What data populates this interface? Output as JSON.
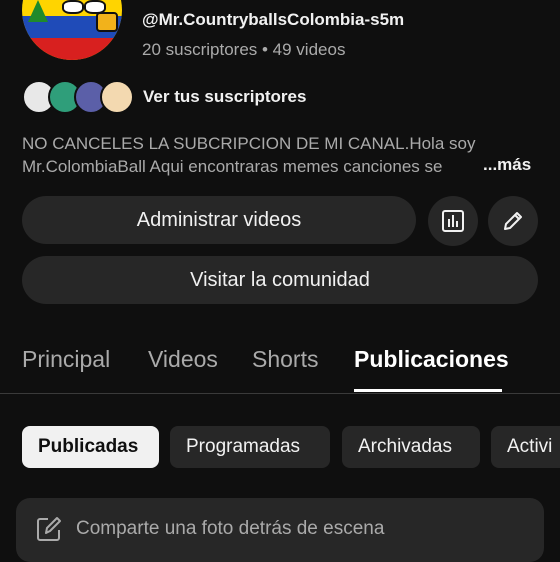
{
  "channel": {
    "handle": "@Mr.CountryballsColombia-s5m",
    "stats": "20 suscriptores • 49 videos",
    "subscribers_link": "Ver tus suscriptores",
    "description_line1": "NO CANCELES LA SUBCRIPCION DE MI CANAL.Hola soy",
    "description_line2": "Mr.ColombiaBall Aqui encontraras memes canciones se",
    "more_label": "...más"
  },
  "actions": {
    "manage_videos": "Administrar videos",
    "analytics_icon": "analytics-icon",
    "edit_icon": "pencil-icon",
    "visit_community": "Visitar la comunidad"
  },
  "tabs": [
    {
      "label": "Principal",
      "active": false
    },
    {
      "label": "Videos",
      "active": false
    },
    {
      "label": "Shorts",
      "active": false
    },
    {
      "label": "Publicaciones",
      "active": true
    }
  ],
  "chips": [
    {
      "label": "Publicadas",
      "active": true
    },
    {
      "label": "Programadas",
      "active": false
    },
    {
      "label": "Archivadas",
      "active": false
    },
    {
      "label": "Activi",
      "active": false
    }
  ],
  "compose": {
    "placeholder": "Comparte una foto detrás de escena",
    "icon": "edit-square-icon"
  },
  "colors": {
    "background": "#0f0f0f",
    "surface": "#272727",
    "text_primary": "#f1f1f1",
    "text_secondary": "#aaaaaa"
  }
}
